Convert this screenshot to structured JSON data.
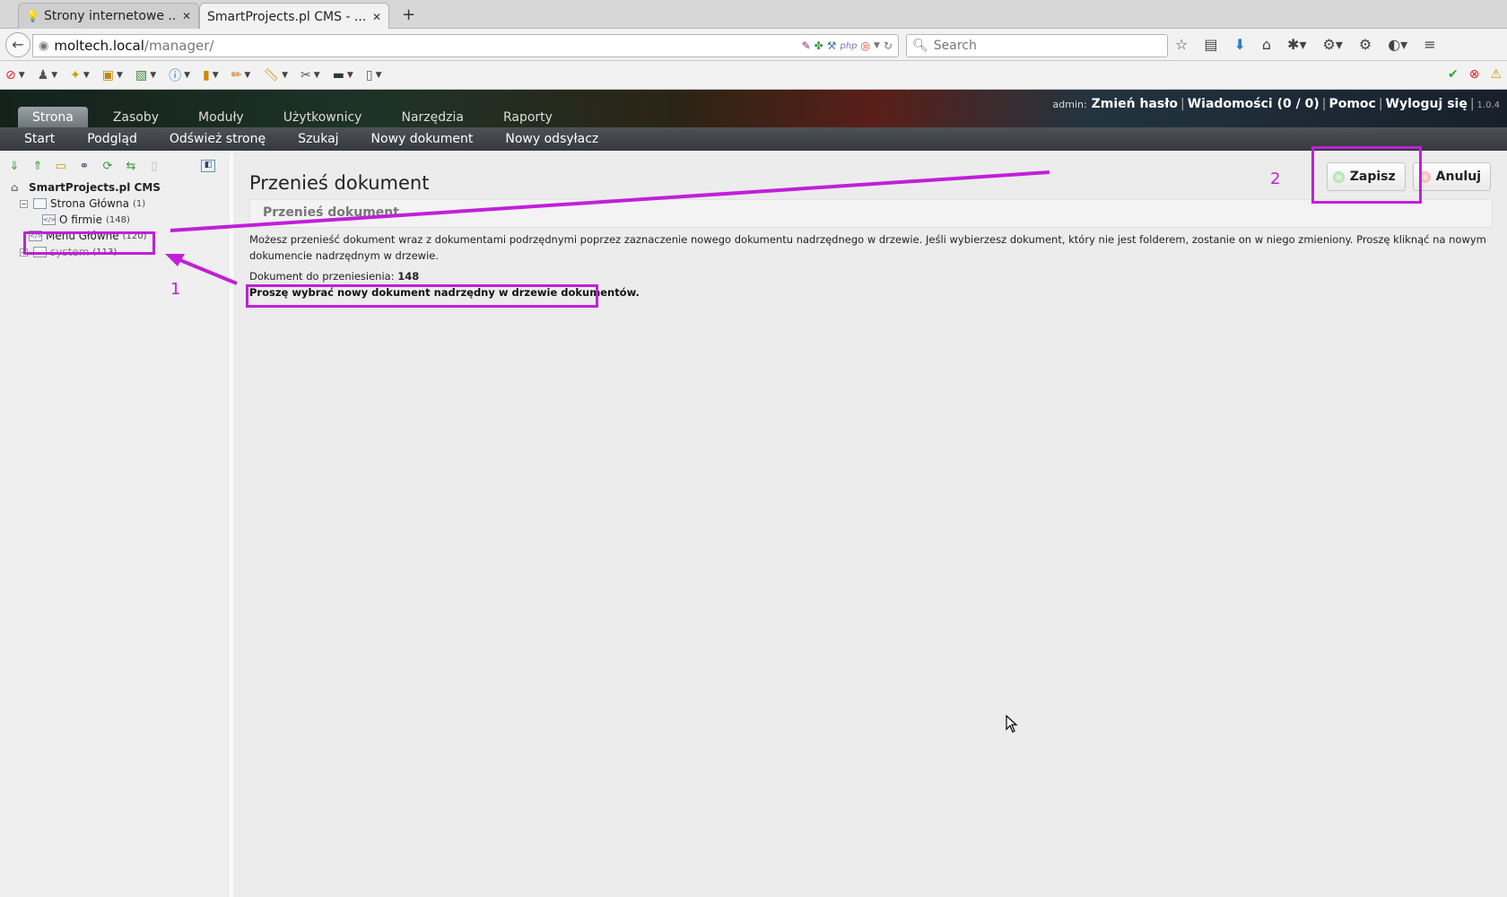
{
  "browser": {
    "tabs": [
      {
        "title": "Strony internetowe ...",
        "active": false
      },
      {
        "title": "SmartProjects.pl CMS - ...",
        "active": true
      }
    ],
    "new_tab_label": "+",
    "url_host": "moltech.local",
    "url_path": "/manager/",
    "search_placeholder": "Search"
  },
  "cms": {
    "top_menu": {
      "user_label": "admin:",
      "change_password": "Zmień hasło",
      "messages": "Wiadomości (0 / 0)",
      "help": "Pomoc",
      "logout": "Wyloguj się",
      "version": "1.0.4"
    },
    "main_tabs": [
      "Strona",
      "Zasoby",
      "Moduły",
      "Użytkownicy",
      "Narzędzia",
      "Raporty"
    ],
    "sub_menu": [
      "Start",
      "Podgląd",
      "Odśwież stronę",
      "Szukaj",
      "Nowy dokument",
      "Nowy odsyłacz"
    ],
    "tree": {
      "root": "SmartProjects.pl CMS",
      "nodes": [
        {
          "name": "Strona Główna",
          "count": "(1)"
        },
        {
          "name": "O firmie",
          "count": "(148)"
        },
        {
          "name": "Menu Główne",
          "count": "(120)"
        },
        {
          "name": "system",
          "count": "(113)"
        }
      ]
    },
    "page": {
      "title": "Przenieś dokument",
      "section_title": "Przenieś dokument",
      "save": "Zapisz",
      "cancel": "Anuluj",
      "description": "Możesz przenieść dokument wraz z dokumentami podrzędnymi poprzez zaznaczenie nowego dokumentu nadrzędnego w drzewie. Jeśli wybierzesz dokument, który nie jest folderem, zostanie on w niego zmieniony. Proszę kliknąć na nowym dokumencie nadrzędnym w drzewie.",
      "doc_to_move_label": "Dokument do przeniesienia:",
      "doc_to_move_id": "148",
      "instruction": "Proszę wybrać nowy dokument nadrzędny w drzewie dokumentów."
    }
  },
  "annotations": {
    "label_1": "1",
    "label_2": "2",
    "color": "#c020d8"
  }
}
